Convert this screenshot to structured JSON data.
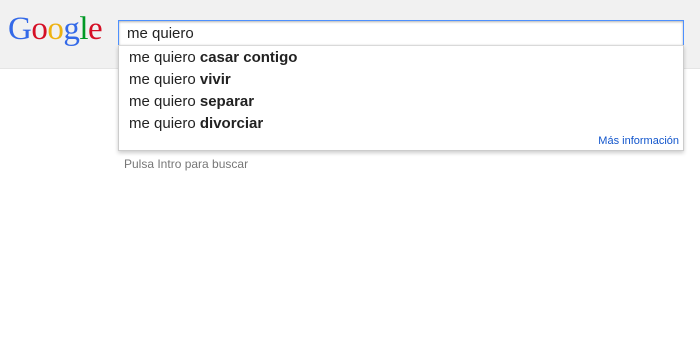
{
  "logo": {
    "letters": [
      "G",
      "o",
      "o",
      "g",
      "l",
      "e"
    ],
    "colors": [
      "#3369e8",
      "#d50f25",
      "#eeb211",
      "#3369e8",
      "#009925",
      "#d50f25"
    ]
  },
  "search": {
    "value": "me quiero"
  },
  "suggestions": [
    {
      "typed": "me quiero ",
      "completion": "casar contigo"
    },
    {
      "typed": "me quiero ",
      "completion": "vivir"
    },
    {
      "typed": "me quiero ",
      "completion": "separar"
    },
    {
      "typed": "me quiero ",
      "completion": "divorciar"
    }
  ],
  "more_info_label": "Más información",
  "hint_text": "Pulsa Intro para buscar",
  "colors": {
    "accent_border": "#4d90fe",
    "link": "#1155cc",
    "topbar_bg": "#f1f1f1"
  }
}
